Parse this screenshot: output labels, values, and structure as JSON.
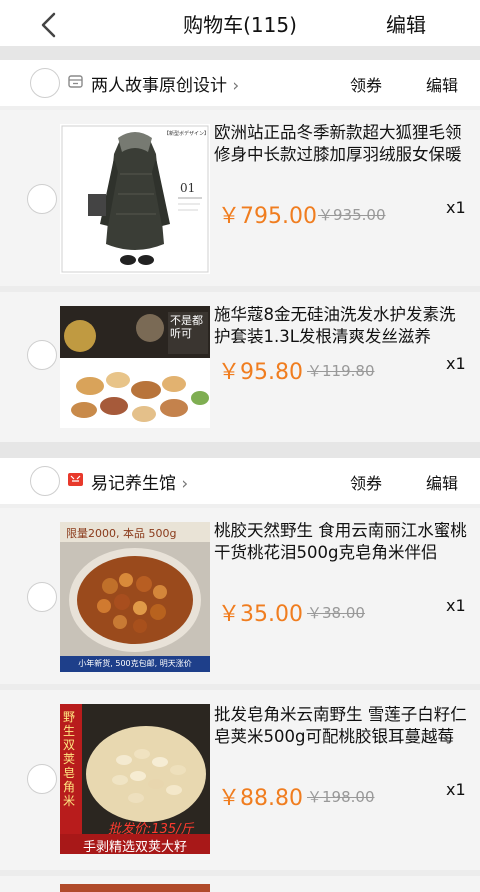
{
  "header": {
    "title": "购物车(115)",
    "edit_label": "编辑"
  },
  "shops": [
    {
      "name": "两人故事原创设计",
      "coupon_label": "领券",
      "edit_label": "编辑",
      "items": [
        {
          "name": "欧洲站正品冬季新款超大狐狸毛领修身中长款过膝加厚羽绒服女保暖",
          "price": "￥795.00",
          "old_price": "￥935.00",
          "qty": "x1",
          "image_text": "【新型ボデザイン】"
        },
        {
          "name": "施华蔻8金无硅油洗发水护发素洗护套装1.3L发根清爽发丝滋养",
          "price": "￥95.80",
          "old_price": "￥119.80",
          "qty": "x1",
          "image_text": "不是都听可"
        }
      ]
    },
    {
      "name": "易记养生馆",
      "coupon_label": "领券",
      "edit_label": "编辑",
      "items": [
        {
          "name": "桃胶天然野生 食用云南丽江水蜜桃干货桃花泪500g克皂角米伴侣",
          "price": "￥35.00",
          "old_price": "￥38.00",
          "qty": "x1",
          "image_text_top": "限量2000, 本品 500g",
          "image_text_bottom": "小年新货, 500克包邮, 明天涨价"
        },
        {
          "name": "批发皂角米云南野生 雪莲子白籽仁皂荚米500g可配桃胶银耳蔓越莓",
          "price": "￥88.80",
          "old_price": "￥198.00",
          "qty": "x1",
          "image_text_left": "野生双荚皂角米",
          "image_text_price": "批发价:135/斤",
          "image_text_bottom": "手剥精选双荚大籽"
        }
      ]
    }
  ],
  "colors": {
    "price": "#f07d1f",
    "shop_icon": "#e8392b",
    "band": "#e6e6e6"
  }
}
